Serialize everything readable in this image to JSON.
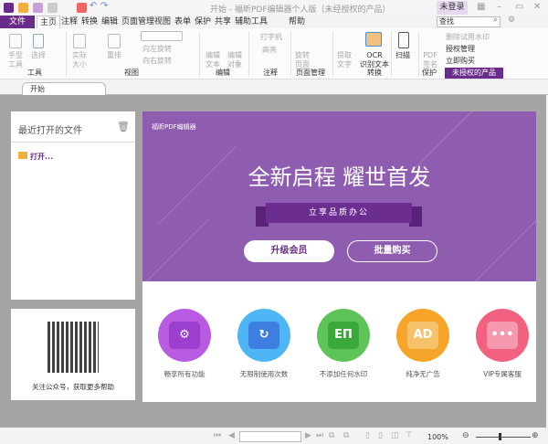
{
  "titlebar": {
    "title": "开始 - 福昕PDF编辑器个人版（未经授权的产品）",
    "login": "未登录"
  },
  "menu": {
    "file": "文件",
    "tabs": [
      "主页",
      "注释",
      "转换",
      "编辑",
      "页面管理",
      "视图",
      "表单",
      "保护",
      "共享",
      "辅助工具",
      "帮助"
    ]
  },
  "search": {
    "placeholder": "查找"
  },
  "ribbon": {
    "tools": [
      "手型\n工具",
      "选择"
    ],
    "group_tools": "工具",
    "view": [
      "实际\n大小",
      "重排",
      "向左旋转",
      "向右旋转"
    ],
    "group_view": "视图",
    "edit": [
      "编辑\n文本",
      "编辑\n对象"
    ],
    "group_edit": "编辑",
    "comment": [
      "打字机",
      "高亮"
    ],
    "group_comment": "注释",
    "pages": [
      "旋转\n页面"
    ],
    "group_pages": "页面管理",
    "convert": [
      "提取\n文字",
      "OCR\n识别文本"
    ],
    "group_convert": "转换",
    "scan": "扫描",
    "protect": [
      "PDF\n签名"
    ],
    "group_protect": "保护",
    "product": [
      "删除试用水印",
      "授权管理",
      "立即购买"
    ],
    "group_product": "未授权的产品"
  },
  "tab": {
    "label": "开始"
  },
  "recent": {
    "title": "最近打开的文件",
    "open": "打开..."
  },
  "qr": {
    "caption": "关注公众号，获取更多帮助"
  },
  "banner": {
    "brand": "福昕PDF编辑器",
    "headline": "全新启程 耀世首发",
    "ribbon_text": "立享品质办公",
    "upgrade": "升级会员",
    "bulk_buy": "批量购买"
  },
  "benefits": [
    {
      "label": "畅享所有功能",
      "color": "#b95be0",
      "inner": "#9a3fcf",
      "glyph": "⚙"
    },
    {
      "label": "无限制使用次数",
      "color": "#4eb6f5",
      "inner": "#3d7ee0",
      "glyph": "↻"
    },
    {
      "label": "不添加任何水印",
      "color": "#5ec45a",
      "inner": "#3aa83a",
      "glyph": "EΠ"
    },
    {
      "label": "纯净无广告",
      "color": "#f7a52a",
      "inner": "#f5c26b",
      "glyph": "AD"
    },
    {
      "label": "VIP专属客服",
      "color": "#f2617f",
      "inner": "#f59aae",
      "glyph": "•••"
    }
  ],
  "status": {
    "zoom": "100%"
  }
}
